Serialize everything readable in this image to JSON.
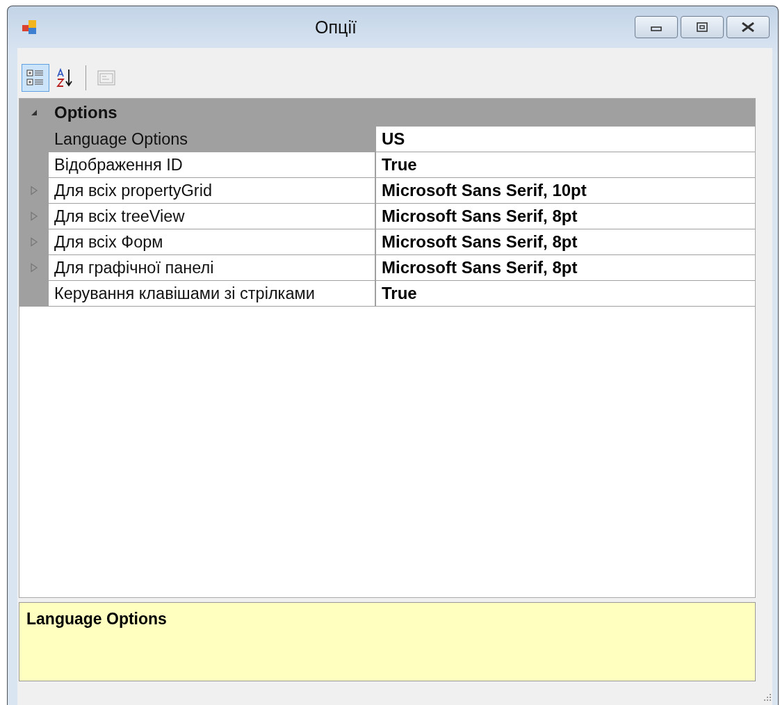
{
  "window": {
    "title": "Опції"
  },
  "toolbar": [
    {
      "kind": "categorized",
      "selected": true,
      "disabled": false
    },
    {
      "kind": "alphabetical",
      "selected": false,
      "disabled": false
    },
    {
      "kind": "property-pages",
      "selected": false,
      "disabled": true
    }
  ],
  "grid": {
    "category": {
      "label": "Options",
      "expanded": true
    },
    "rows": [
      {
        "name": "Language Options",
        "value": "US",
        "expandable": false,
        "selected": true
      },
      {
        "name": "Відображення ID",
        "value": "True",
        "expandable": false,
        "selected": false
      },
      {
        "name": "Для всіх propertyGrid",
        "value": "Microsoft Sans Serif, 10pt",
        "expandable": true,
        "selected": false
      },
      {
        "name": "Для всіх treeView",
        "value": "Microsoft Sans Serif, 8pt",
        "expandable": true,
        "selected": false
      },
      {
        "name": "Для всіх Форм",
        "value": "Microsoft Sans Serif, 8pt",
        "expandable": true,
        "selected": false
      },
      {
        "name": "Для графічної панелі",
        "value": "Microsoft Sans Serif, 8pt",
        "expandable": true,
        "selected": false
      },
      {
        "name": "Керування клавішами зі стрілками",
        "value": "True",
        "expandable": false,
        "selected": false
      }
    ]
  },
  "description": {
    "title": "Language Options"
  }
}
